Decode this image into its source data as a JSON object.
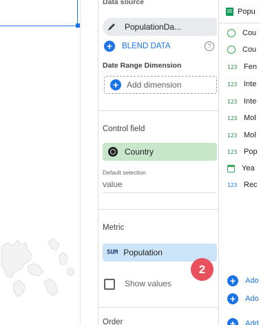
{
  "data_source": {
    "section_title": "Data source",
    "source_name": "PopulationDa...",
    "blend_label": "BLEND DATA",
    "help_glyph": "?"
  },
  "date_range": {
    "section_title": "Date Range Dimension",
    "add_label": "Add dimension"
  },
  "control_field": {
    "section_title": "Control field",
    "field_name": "Country",
    "default_selection_label": "Default selection",
    "default_value": "value"
  },
  "metric": {
    "section_title": "Metric",
    "aggregation": "SUM",
    "field_name": "Population",
    "show_values_label": "Show values"
  },
  "order": {
    "section_title": "Order"
  },
  "badge": {
    "number": "2",
    "color": "#e8505b"
  },
  "field_list": {
    "header": "Popu",
    "fields": [
      {
        "icon": "globe-icon",
        "label": "Cou"
      },
      {
        "icon": "globe-icon",
        "label": "Cou"
      },
      {
        "icon": "number-icon",
        "type_text": "123",
        "label": "Fen"
      },
      {
        "icon": "number-icon",
        "type_text": "123",
        "label": "Inte"
      },
      {
        "icon": "number-icon",
        "type_text": "123",
        "label": "Inte"
      },
      {
        "icon": "number-icon",
        "type_text": "123",
        "label": "Mol"
      },
      {
        "icon": "number-icon",
        "type_text": "123",
        "label": "Mol"
      },
      {
        "icon": "number-icon",
        "type_text": "123",
        "label": "Pop"
      },
      {
        "icon": "calendar-icon",
        "label": "Yea"
      },
      {
        "icon": "number-icon",
        "type_text": "123",
        "label": "Rec"
      }
    ],
    "add_buttons": [
      "Ado",
      "Ado",
      "Add"
    ]
  },
  "colors": {
    "accent": "#1a73e8",
    "dimension_green": "#c8e6c9",
    "metric_blue": "#cce4f7"
  }
}
